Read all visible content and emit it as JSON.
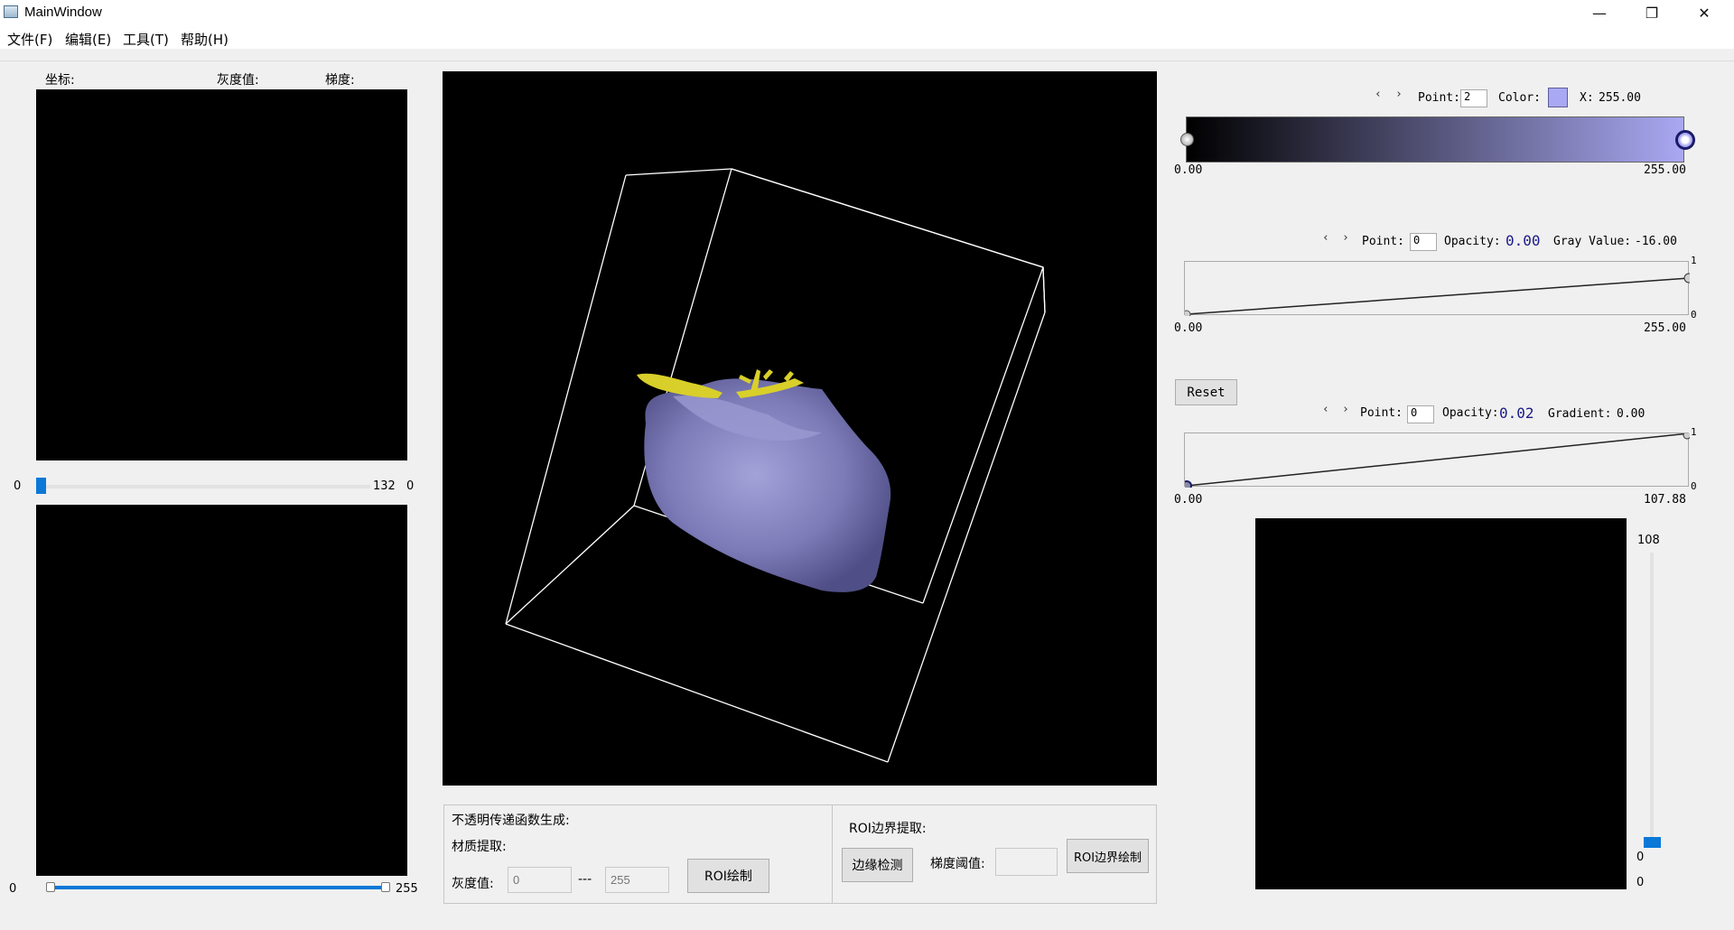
{
  "window": {
    "title": "MainWindow",
    "minimize": "—",
    "maximize": "❐",
    "close": "✕"
  },
  "menu": [
    "文件(F)",
    "编辑(E)",
    "工具(T)",
    "帮助(H)"
  ],
  "left_panel": {
    "coord_label": "坐标:",
    "gray_label": "灰度值:",
    "gradient_label": "梯度:",
    "slice_slider": {
      "min": "0",
      "value_text": "132",
      "right": "0",
      "value_fraction": 0.0
    },
    "range_slider": {
      "min": "0",
      "max": "255",
      "low_fraction": 0.0,
      "high_fraction": 1.0
    }
  },
  "opacity_panel": {
    "title": "不透明传递函数生成:",
    "material_label": "材质提取:",
    "gray_label": "灰度值:",
    "gray_min_placeholder": "0",
    "dash": "---",
    "gray_max_placeholder": "255",
    "roi_draw_button": "ROI绘制"
  },
  "roi_panel": {
    "title": "ROI边界提取:",
    "edge_detect_button": "边缘检测",
    "grad_threshold_label": "梯度阈值:",
    "grad_threshold_value": "",
    "roi_boundary_draw_button": "ROI边界绘制"
  },
  "color_tf": {
    "prev": "‹",
    "next": "›",
    "point_label": "Point:",
    "point_value": "2",
    "color_label": "Color:",
    "color_value": "#a9a8f2",
    "x_label": "X:",
    "x_value": "255.00",
    "min_label": "0.00",
    "max_label": "255.00",
    "gradient_start": "#000000",
    "gradient_end": "#a9a8f2"
  },
  "scalar_opacity": {
    "prev": "‹",
    "next": "›",
    "point_label": "Point:",
    "point_value": "0",
    "opacity_label": "Opacity:",
    "opacity_value": "0.00",
    "gray_label": "Gray Value:",
    "gray_value": "-16.00",
    "top_tick": "1",
    "bottom_tick": "0",
    "min_label": "0.00",
    "max_label": "255.00"
  },
  "reset_button": "Reset",
  "gradient_opacity": {
    "prev": "‹",
    "next": "›",
    "point_label": "Point:",
    "point_value": "0",
    "opacity_label": "Opacity:",
    "opacity_value": "0.02",
    "gradient_label": "Gradient:",
    "gradient_value": "0.00",
    "top_tick": "1",
    "bottom_tick": "0",
    "min_label": "0.00",
    "max_label": "107.88"
  },
  "right_slider": {
    "top": "108",
    "value_text": "0",
    "bottom": "0",
    "value_fraction": 0.0
  },
  "colors": {
    "volume": "#7c7bb8",
    "vessel": "#d9cf2a",
    "bbox": "#ffffff",
    "accent": "#0a78d7"
  }
}
